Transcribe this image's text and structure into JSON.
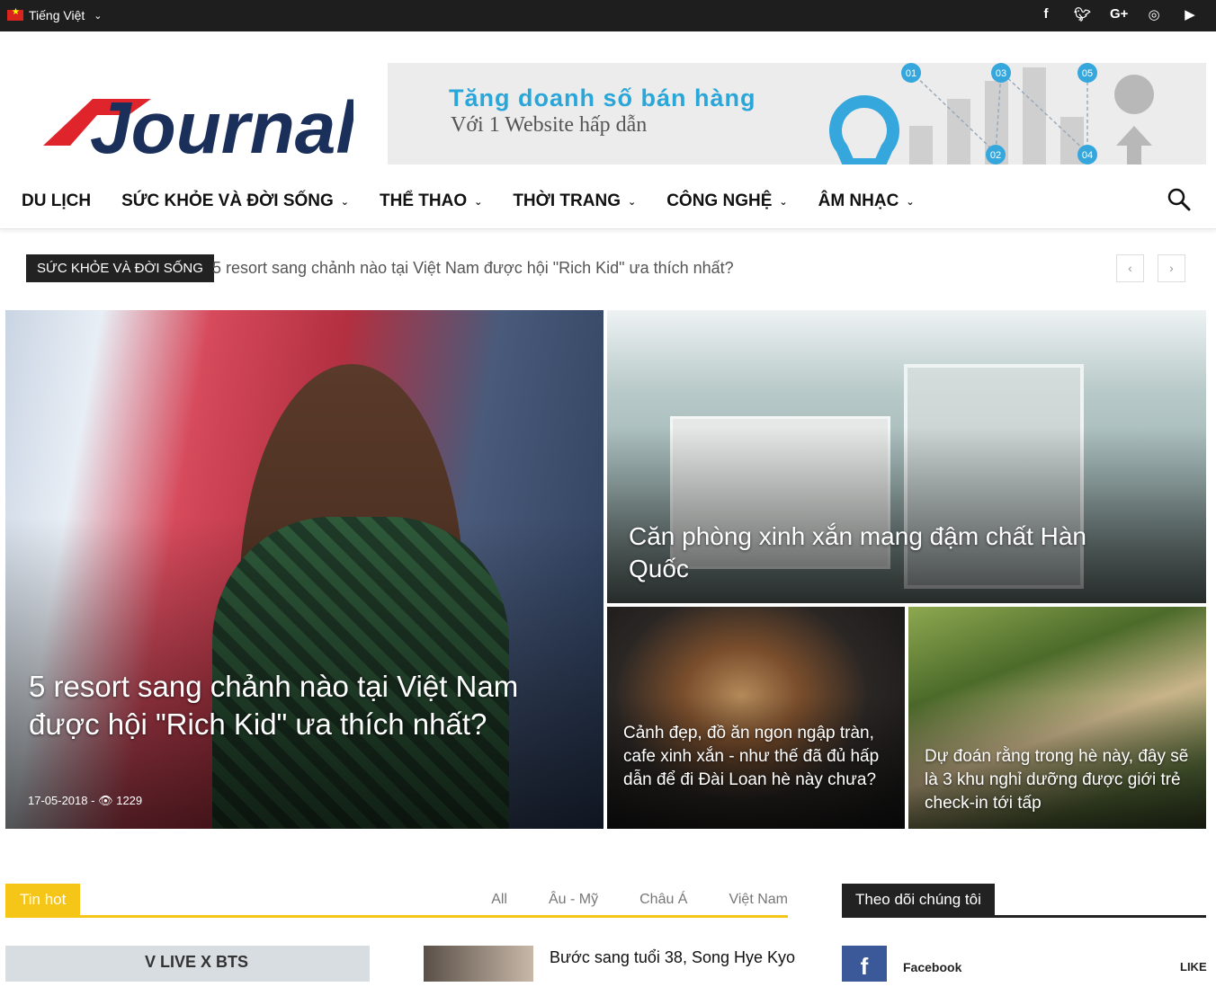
{
  "topbar": {
    "language": "Tiếng Việt",
    "socials": [
      "facebook-icon",
      "twitter-icon",
      "google-plus-icon",
      "instagram-icon",
      "youtube-icon"
    ]
  },
  "header": {
    "logo_text": "Journal",
    "banner": {
      "line1": "Tăng doanh số bán hàng",
      "line2": "Với 1 Website hấp dẫn",
      "steps": [
        "01",
        "02",
        "03",
        "04",
        "05"
      ]
    }
  },
  "nav": {
    "items": [
      {
        "label": "DU LỊCH",
        "dropdown": false
      },
      {
        "label": "SỨC KHỎE VÀ ĐỜI SỐNG",
        "dropdown": true
      },
      {
        "label": "THỂ THAO",
        "dropdown": true
      },
      {
        "label": "THỜI TRANG",
        "dropdown": true
      },
      {
        "label": "CÔNG NGHỆ",
        "dropdown": true
      },
      {
        "label": "ÂM NHẠC",
        "dropdown": true
      }
    ]
  },
  "trending": {
    "label": "SỨC KHỎE VÀ ĐỜI SỐNG",
    "headline": "5 resort sang chảnh nào tại Việt Nam được hội \"Rich Kid\" ưa thích nhất?",
    "prev": "‹",
    "next": "›"
  },
  "featured": {
    "main": {
      "title": "5 resort sang chảnh nào tại Việt Nam được hội \"Rich Kid\" ưa thích nhất?",
      "date": "17-05-2018",
      "views": "1229"
    },
    "room": {
      "title": "Căn phòng xinh xắn mang đậm chất Hàn Quốc"
    },
    "food": {
      "title": "Cảnh đẹp, đồ ăn ngon ngập tràn, cafe xinh xắn - như thế đã đủ hấp dẫn để đi Đài Loan hè này chưa?"
    },
    "house": {
      "title": "Dự đoán rằng trong hè này, đây sẽ là 3 khu nghỉ dưỡng được giới trẻ check-in tới tấp"
    }
  },
  "tinhot": {
    "label": "Tin hot",
    "tabs": [
      "All",
      "Âu - Mỹ",
      "Châu Á",
      "Việt Nam"
    ],
    "thumb_text": "V LIVE X BTS",
    "article_title": "Bước sang tuổi 38, Song Hye Kyo"
  },
  "follow": {
    "label": "Theo dõi chúng tôi",
    "network": "Facebook",
    "action": "LIKE"
  },
  "colors": {
    "accent": "#f5c518",
    "topbar": "#1e1e1e",
    "facebook": "#3b5998",
    "logo_red": "#e0242c",
    "logo_navy": "#1a2f5a"
  }
}
